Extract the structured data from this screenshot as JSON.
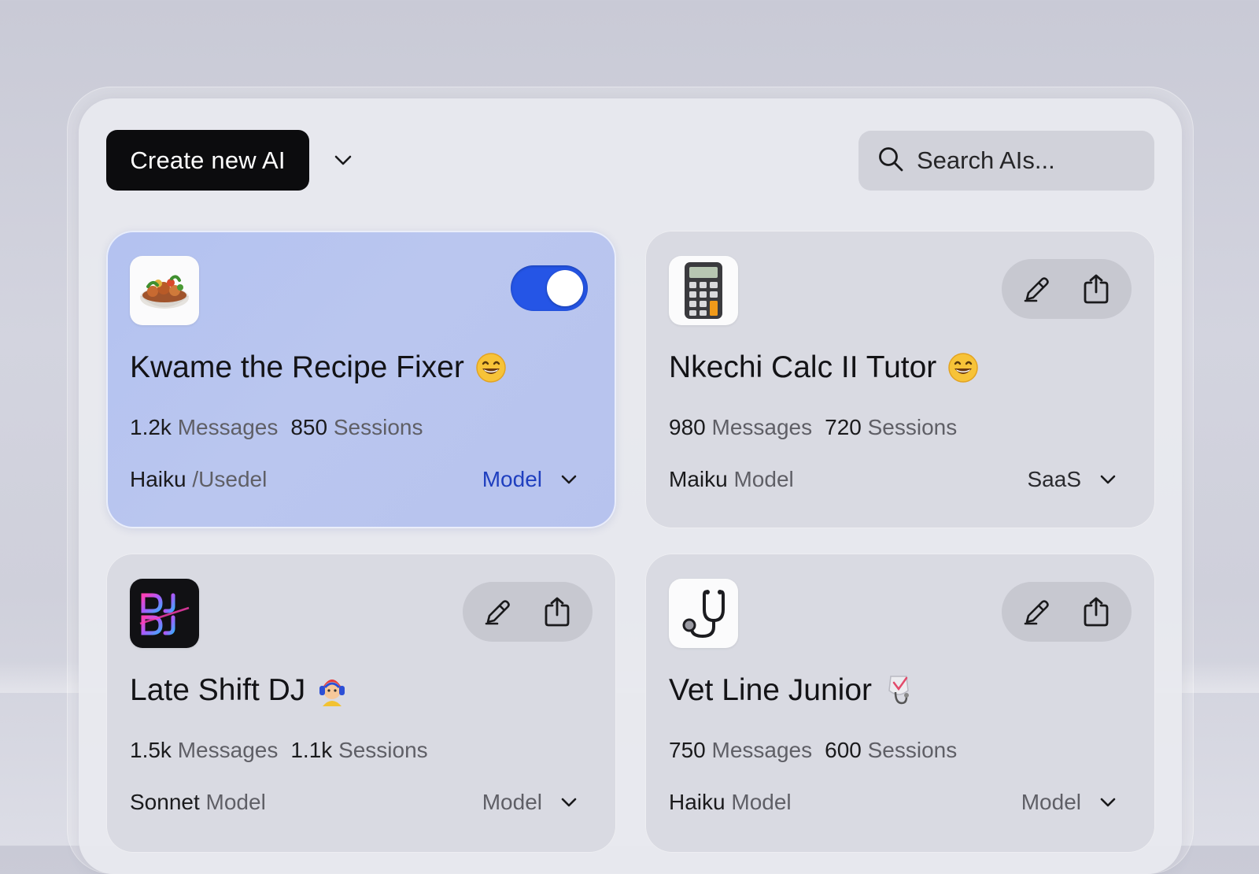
{
  "toolbar": {
    "create_label": "Create new AI",
    "search_placeholder": "Search AIs..."
  },
  "colors": {
    "active_card": "#b6c3ef",
    "toggle_on": "#2555e6",
    "primary_button": "#0c0c0e",
    "model_link": "#1f3fbf"
  },
  "cards": [
    {
      "name": "Kwame the Recipe Fixer",
      "avatar_icon": "food-bowl-icon",
      "title_emoji": "grinning-emoji",
      "messages_value": "1.2k",
      "messages_label": "Messages",
      "sessions_value": "850",
      "sessions_label": "Sessions",
      "model_name": "Haiku",
      "model_suffix": "/Usedel",
      "select_label": "Model",
      "toggle_on": true
    },
    {
      "name": "Nkechi Calc II Tutor",
      "avatar_icon": "calculator-icon",
      "title_emoji": "grinning-emoji",
      "messages_value": "980",
      "messages_label": "Messages",
      "sessions_value": "720",
      "sessions_label": "Sessions",
      "model_name": "Maiku",
      "model_suffix": "Model",
      "select_label": "SaaS"
    },
    {
      "name": "Late Shift DJ",
      "avatar_icon": "dj-logo-icon",
      "title_emoji": "dj-character-emoji",
      "messages_value": "1.5k",
      "messages_label": "Messages",
      "sessions_value": "1.1k",
      "sessions_label": "Sessions",
      "model_name": "Sonnet",
      "model_suffix": "Model",
      "select_label": "Model"
    },
    {
      "name": "Vet Line Junior",
      "avatar_icon": "stethoscope-icon",
      "title_emoji": "stethoscope-badge-emoji",
      "messages_value": "750",
      "messages_label": "Messages",
      "sessions_value": "600",
      "sessions_label": "Sessions",
      "model_name": "Haiku",
      "model_suffix": "Model",
      "select_label": "Model"
    }
  ]
}
